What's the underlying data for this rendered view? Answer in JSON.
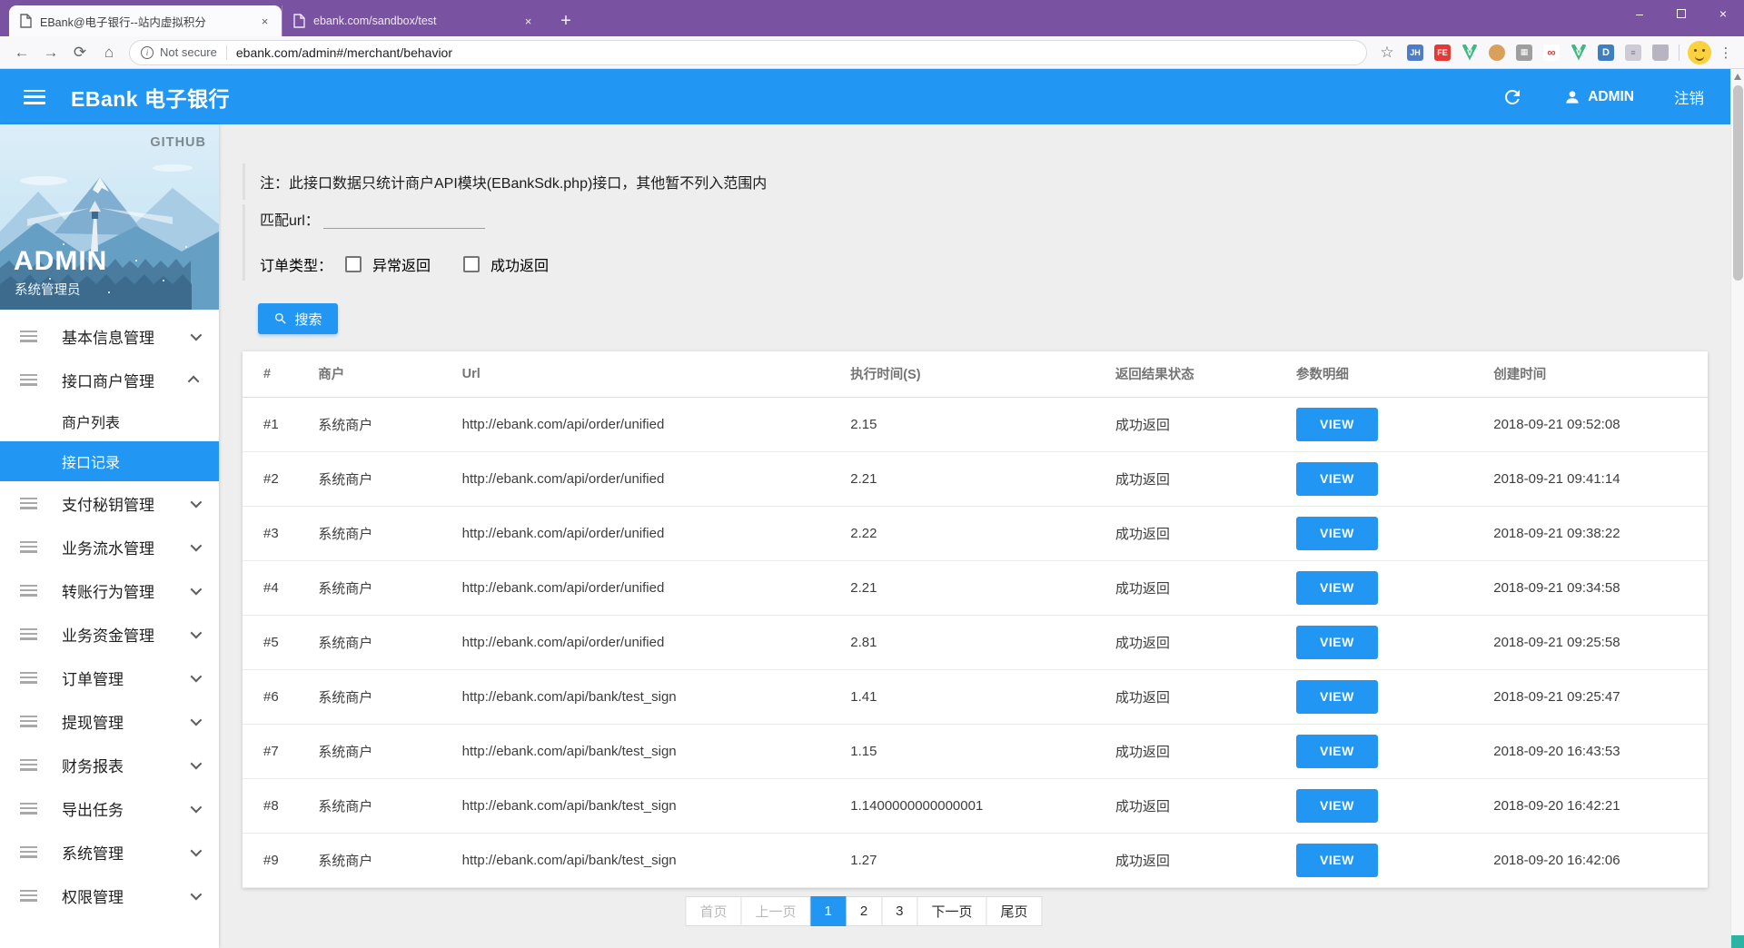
{
  "colors": {
    "accent_blue": "#2196F3",
    "chrome_purple": "#7A52A2",
    "content_bg": "#EEEEEE",
    "corner_accent_teal": "#2BB3A3"
  },
  "icons": {
    "tab_favicon": "page-document",
    "new_tab": "plus",
    "back": "arrow-left",
    "forward": "arrow-right",
    "reload": "circular-arrow",
    "home": "house",
    "omnibox_info": "info-circle",
    "bookmark": "star-outline",
    "app_menu": "hamburger",
    "header_refresh": "circular-arrow",
    "header_user": "person",
    "menu_item": "list-lines",
    "expand": "chevron",
    "search": "magnifier"
  },
  "browser": {
    "tabs": [
      {
        "title": "EBank@电子银行--站内虚拟积分",
        "close": "×"
      },
      {
        "title": "ebank.com/sandbox/test",
        "close": "×"
      }
    ],
    "new_tab_label": "+",
    "nav": {
      "back": "←",
      "forward": "→",
      "reload": "⟳",
      "home": "⌂"
    },
    "address": {
      "info": "i",
      "security": "Not secure",
      "url": "ebank.com/admin#/merchant/behavior"
    },
    "bookmark_star": "☆",
    "extensions": {
      "jh": "JH",
      "fe": "FE",
      "vue1": "V",
      "infinity": "∞",
      "vue2": "V",
      "d": "D"
    },
    "window": {
      "minimize": "–",
      "close": "×"
    }
  },
  "header": {
    "title": "EBank 电子银行",
    "user": "ADMIN",
    "logout": "注销"
  },
  "sidebar": {
    "banner": {
      "tag": "GITHUB",
      "name": "ADMIN",
      "role": "系统管理员"
    },
    "menu": [
      {
        "label": "基本信息管理"
      },
      {
        "label": "接口商户管理",
        "children": [
          {
            "label": "商户列表"
          },
          {
            "label": "接口记录",
            "active": true
          }
        ]
      },
      {
        "label": "支付秘钥管理"
      },
      {
        "label": "业务流水管理"
      },
      {
        "label": "转账行为管理"
      },
      {
        "label": "业务资金管理"
      },
      {
        "label": "订单管理"
      },
      {
        "label": "提现管理"
      },
      {
        "label": "财务报表"
      },
      {
        "label": "导出任务"
      },
      {
        "label": "系统管理"
      },
      {
        "label": "权限管理"
      }
    ]
  },
  "main": {
    "note": "注：此接口数据只统计商户API模块(EBankSdk.php)接口，其他暂不列入范围内",
    "filters": {
      "url_label": "匹配url：",
      "type_label": "订单类型：",
      "checkbox1": "异常返回",
      "checkbox2": "成功返回",
      "search_label": "搜索"
    },
    "table": {
      "columns": [
        "#",
        "商户",
        "Url",
        "执行时间(S)",
        "返回结果状态",
        "参数明细",
        "创建时间"
      ],
      "action_label": "VIEW",
      "rows": [
        {
          "id": "#1",
          "merchant": "系统商户",
          "url": "http://ebank.com/api/order/unified",
          "time": "2.15",
          "status": "成功返回",
          "action": "VIEW",
          "created": "2018-09-21 09:52:08"
        },
        {
          "id": "#2",
          "merchant": "系统商户",
          "url": "http://ebank.com/api/order/unified",
          "time": "2.21",
          "status": "成功返回",
          "action": "VIEW",
          "created": "2018-09-21 09:41:14"
        },
        {
          "id": "#3",
          "merchant": "系统商户",
          "url": "http://ebank.com/api/order/unified",
          "time": "2.22",
          "status": "成功返回",
          "action": "VIEW",
          "created": "2018-09-21 09:38:22"
        },
        {
          "id": "#4",
          "merchant": "系统商户",
          "url": "http://ebank.com/api/order/unified",
          "time": "2.21",
          "status": "成功返回",
          "action": "VIEW",
          "created": "2018-09-21 09:34:58"
        },
        {
          "id": "#5",
          "merchant": "系统商户",
          "url": "http://ebank.com/api/order/unified",
          "time": "2.81",
          "status": "成功返回",
          "action": "VIEW",
          "created": "2018-09-21 09:25:58"
        },
        {
          "id": "#6",
          "merchant": "系统商户",
          "url": "http://ebank.com/api/bank/test_sign",
          "time": "1.41",
          "status": "成功返回",
          "action": "VIEW",
          "created": "2018-09-21 09:25:47"
        },
        {
          "id": "#7",
          "merchant": "系统商户",
          "url": "http://ebank.com/api/bank/test_sign",
          "time": "1.15",
          "status": "成功返回",
          "action": "VIEW",
          "created": "2018-09-20 16:43:53"
        },
        {
          "id": "#8",
          "merchant": "系统商户",
          "url": "http://ebank.com/api/bank/test_sign",
          "time": "1.1400000000000001",
          "status": "成功返回",
          "action": "VIEW",
          "created": "2018-09-20 16:42:21"
        },
        {
          "id": "#9",
          "merchant": "系统商户",
          "url": "http://ebank.com/api/bank/test_sign",
          "time": "1.27",
          "status": "成功返回",
          "action": "VIEW",
          "created": "2018-09-20 16:42:06"
        }
      ]
    },
    "pagination": {
      "items": [
        "首页",
        "上一页",
        "1",
        "2",
        "3",
        "下一页",
        "尾页"
      ],
      "active_page": "1"
    }
  }
}
